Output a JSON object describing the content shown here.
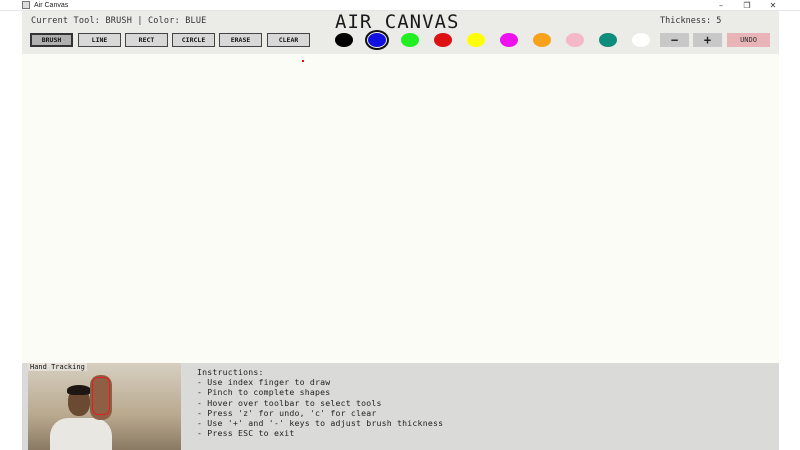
{
  "window": {
    "title": "Air Canvas",
    "controls": {
      "minimize": "–",
      "maximize": "❐",
      "close": "✕"
    }
  },
  "toolbar": {
    "status": "Current Tool: BRUSH | Color: BLUE",
    "app_title": "AIR CANVAS",
    "thickness_label": "Thickness: 5",
    "tools": [
      "BRUSH",
      "LINE",
      "RECT",
      "CIRCLE",
      "ERASE",
      "CLEAR"
    ],
    "selected_tool": "BRUSH",
    "colors": [
      {
        "name": "black",
        "hex": "#000000"
      },
      {
        "name": "blue",
        "hex": "#1010e0"
      },
      {
        "name": "green",
        "hex": "#22ee22"
      },
      {
        "name": "red",
        "hex": "#dd1111"
      },
      {
        "name": "yellow",
        "hex": "#ffff00"
      },
      {
        "name": "magenta",
        "hex": "#ee10ee"
      },
      {
        "name": "orange",
        "hex": "#f7a21a"
      },
      {
        "name": "pink",
        "hex": "#f4b8c8"
      },
      {
        "name": "teal",
        "hex": "#0e8c7c"
      },
      {
        "name": "white",
        "hex": "#ffffff"
      }
    ],
    "selected_color": "blue",
    "minus_label": "−",
    "plus_label": "+",
    "undo_label": "UNDO"
  },
  "bottom": {
    "hand_label": "Hand Tracking",
    "instructions_title": "Instructions:",
    "instructions": [
      "- Use index finger to draw",
      "- Pinch to complete shapes",
      "- Hover over toolbar to select tools",
      "- Press 'z' for undo, 'c' for clear",
      "- Use '+' and '-' keys to adjust brush thickness",
      "- Press ESC to exit"
    ]
  }
}
